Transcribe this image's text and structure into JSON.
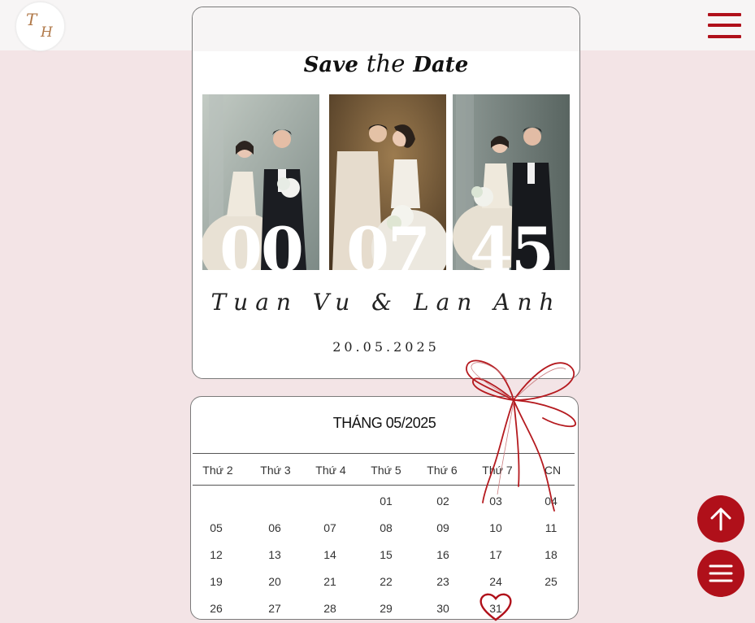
{
  "header": {
    "logo": {
      "text_line1": "T",
      "text_line2": "H"
    },
    "menu_icon": "hamburger-menu-icon"
  },
  "save_the_date": {
    "word1": "Save",
    "word2": "the",
    "word3": "Date",
    "countdown": [
      "00",
      "07",
      "45"
    ],
    "couple_names": "Tuan Vu & Lan Anh",
    "wedding_date": "20.05.2025"
  },
  "calendar": {
    "title": "THÁNG 05/2025",
    "weekdays": [
      "Thứ 2",
      "Thứ 3",
      "Thứ 4",
      "Thứ 5",
      "Thứ 6",
      "Thứ 7",
      "CN"
    ],
    "weeks": [
      [
        "",
        "",
        "",
        "01",
        "02",
        "03",
        "04"
      ],
      [
        "05",
        "06",
        "07",
        "08",
        "09",
        "10",
        "11"
      ],
      [
        "12",
        "13",
        "14",
        "15",
        "16",
        "17",
        "18"
      ],
      [
        "19",
        "20",
        "21",
        "22",
        "23",
        "24",
        "25"
      ],
      [
        "26",
        "27",
        "28",
        "29",
        "30",
        "31",
        ""
      ]
    ],
    "highlight_day": "31"
  },
  "colors": {
    "accent": "#b0101a",
    "background": "#f3e4e6"
  },
  "buttons": {
    "scroll_top_icon": "arrow-up-icon",
    "menu_fab_icon": "hamburger-menu-icon"
  }
}
